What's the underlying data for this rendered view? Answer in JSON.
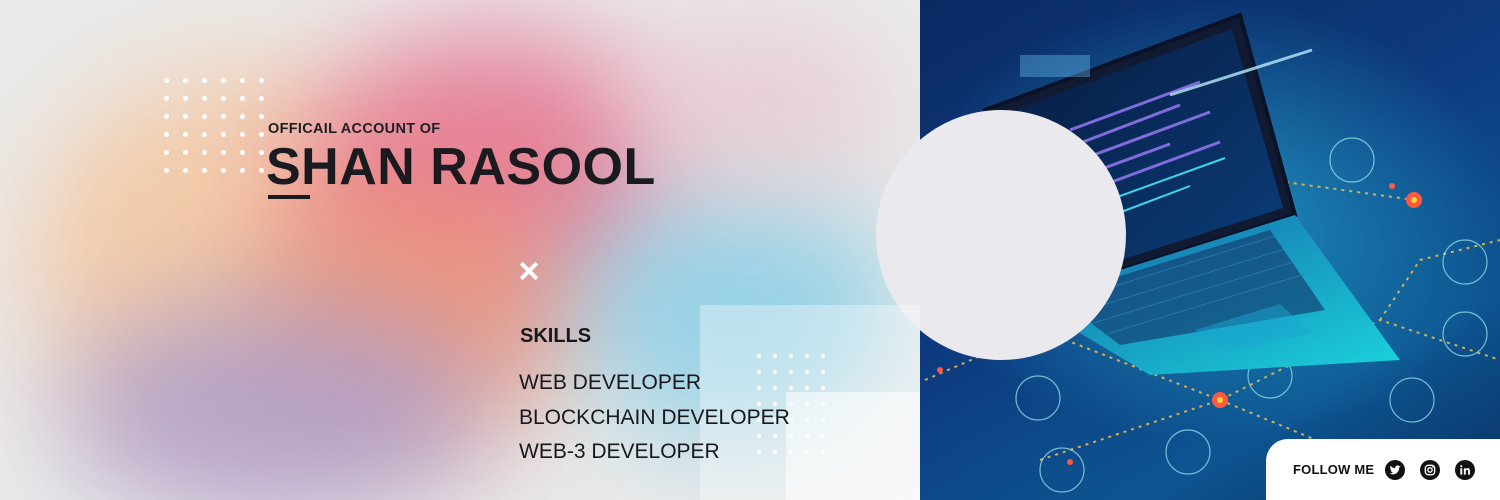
{
  "header": {
    "subtitle": "OFFICAIL ACCOUNT OF",
    "name": "SHAN RASOOL"
  },
  "skills": {
    "title": "SKILLS",
    "items": [
      "WEB DEVELOPER",
      "BLOCKCHAIN DEVELOPER",
      "WEB-3 DEVELOPER"
    ]
  },
  "follow": {
    "label": "FOLLOW ME",
    "icons": [
      "twitter-icon",
      "instagram-icon",
      "linkedin-icon"
    ]
  },
  "colors": {
    "text": "#1b1b1f",
    "accent_pink": "#e56f8d",
    "accent_cyan": "#20d7e7",
    "node_red": "#ff4d4d",
    "tech_bg": "#0d3b7f"
  }
}
